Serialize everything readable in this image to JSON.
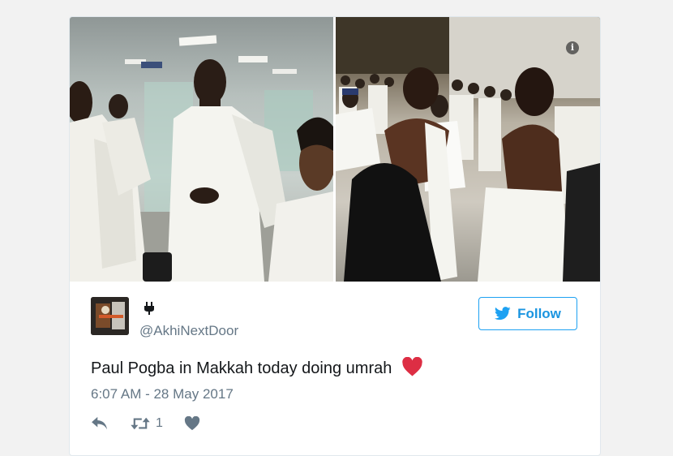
{
  "tweet": {
    "name_glyph": "ὐC",
    "handle": "@AkhiNextDoor",
    "follow_label": "Follow",
    "text": "Paul Pogba in Makkah today doing umrah",
    "emoji": "red-heart",
    "timestamp": "6:07 AM - 28 May 2017",
    "retweet_count": "1"
  },
  "icons": {
    "info": "info-icon",
    "reply": "reply-icon",
    "retweet": "retweet-icon",
    "like": "heart-icon",
    "follow": "twitter-bird-icon"
  },
  "colors": {
    "accent": "#1da1f2",
    "text": "#14171a",
    "muted": "#657786",
    "heart": "#e0245e"
  }
}
